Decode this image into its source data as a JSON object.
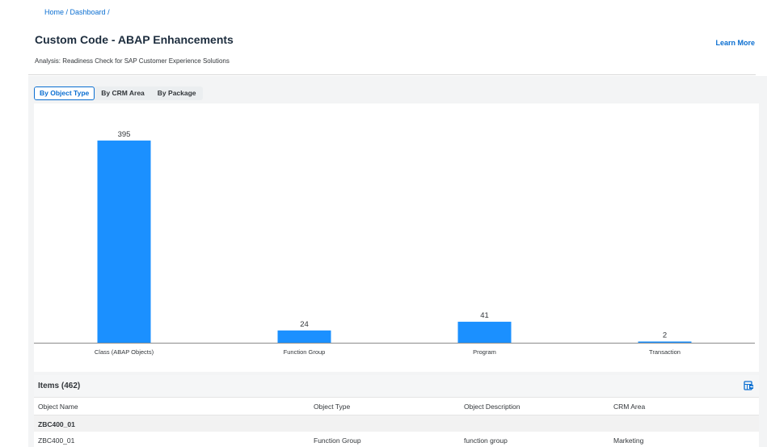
{
  "breadcrumb": {
    "home": "Home",
    "sep1": " / ",
    "dashboard": "Dashboard",
    "sep2": " /"
  },
  "page": {
    "title": "Custom Code - ABAP Enhancements",
    "subtitle": "Analysis: Readiness Check for SAP Customer Experience Solutions",
    "learn_more": "Learn More"
  },
  "tabs": [
    {
      "label": "By Object Type",
      "active": true
    },
    {
      "label": "By CRM Area",
      "active": false
    },
    {
      "label": "By Package",
      "active": false
    }
  ],
  "chart_data": {
    "type": "bar",
    "categories": [
      "Class (ABAP Objects)",
      "Function Group",
      "Program",
      "Transaction"
    ],
    "values": [
      395,
      24,
      41,
      2
    ],
    "title": "",
    "xlabel": "",
    "ylabel": "",
    "ylim": [
      0,
      420
    ],
    "grid": false,
    "legend": "none",
    "bar_color": "#1b90ff"
  },
  "table": {
    "title": "Items (462)",
    "export_icon": "export-to-spreadsheet-icon",
    "columns": [
      "Object Name",
      "Object Type",
      "Object Description",
      "CRM Area"
    ],
    "group_label": "ZBC400_01",
    "rows": [
      {
        "name": "ZBC400_01",
        "type": "Function Group",
        "description": "function group",
        "area": "Marketing"
      }
    ]
  },
  "colors": {
    "accent": "#0a6ed1",
    "bar": "#1b90ff",
    "background": "#f3f4f5"
  }
}
